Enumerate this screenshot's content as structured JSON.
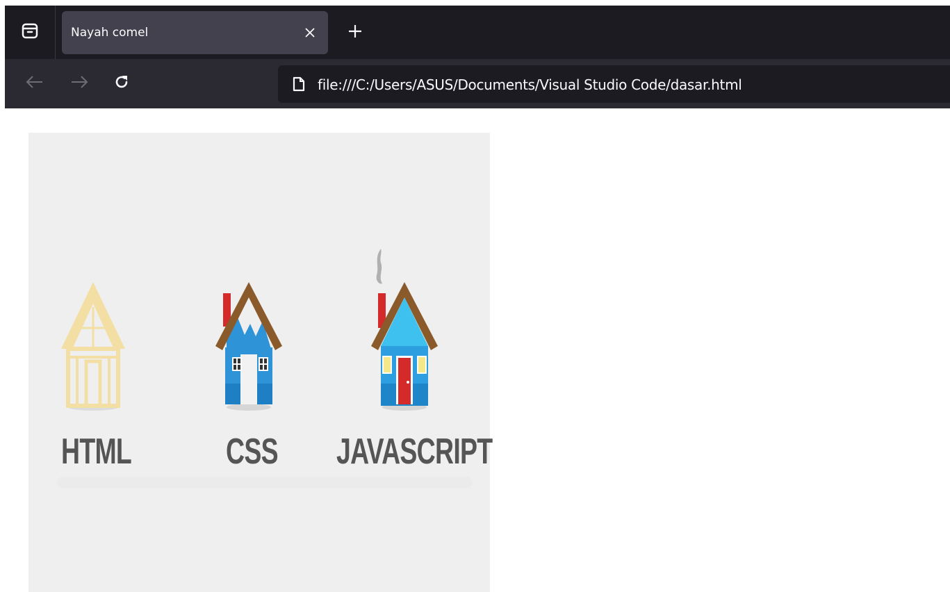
{
  "browser": {
    "tab": {
      "title": "Nayah comel"
    },
    "address_bar": {
      "url": "file:///C:/Users/ASUS/Documents/Visual Studio Code/dasar.html"
    },
    "icons": [
      "tab-manager-icon",
      "close-icon",
      "plus-icon",
      "back-arrow-icon",
      "forward-arrow-icon",
      "reload-icon",
      "page-icon"
    ],
    "colors": {
      "tabbar": "#1c1b22",
      "active_tab": "#42414d",
      "toolbar": "#2b2a33",
      "urlbar": "#1c1b22",
      "text": "#fbfbfe"
    }
  },
  "page": {
    "image": {
      "background": "#efefef",
      "houses": [
        {
          "label": "HTML",
          "icon": "house-outline-icon",
          "color": "#f3dfa3"
        },
        {
          "label": "CSS",
          "icon": "house-blue-icon",
          "color": "#2f93d8"
        },
        {
          "label": "JAVASCRIPT",
          "icon": "house-complete-icon",
          "color": "#3aaee8"
        }
      ]
    }
  }
}
